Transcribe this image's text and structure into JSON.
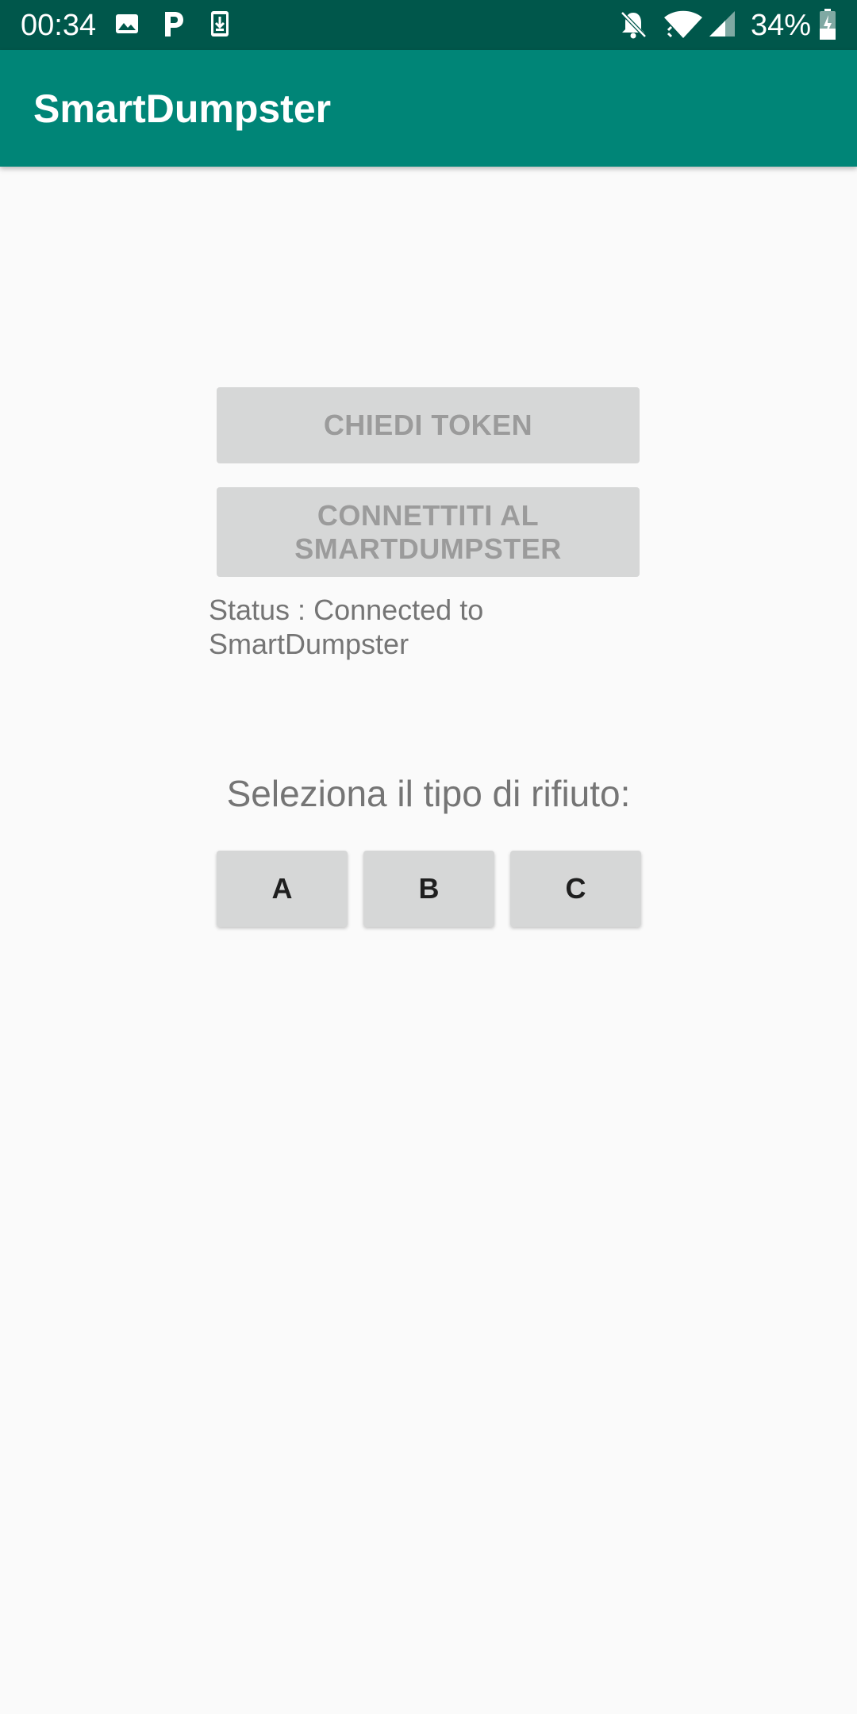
{
  "status_bar": {
    "time": "00:34",
    "battery_percent": "34%",
    "icons": [
      "image-icon",
      "parking-p-icon",
      "download-icon",
      "bell-off-icon",
      "wifi-icon",
      "cell-signal-icon",
      "battery-charging-icon"
    ]
  },
  "app_bar": {
    "title": "SmartDumpster",
    "color": "#008577"
  },
  "main": {
    "token_button_label": "CHIEDI TOKEN",
    "connect_button_label": "CONNETTITI AL SMARTDUMPSTER",
    "status_text": "Status : Connected to SmartDumpster",
    "select_label": "Seleziona il tipo di rifiuto:",
    "type_buttons": [
      {
        "label": "A"
      },
      {
        "label": "B"
      },
      {
        "label": "C"
      }
    ]
  }
}
